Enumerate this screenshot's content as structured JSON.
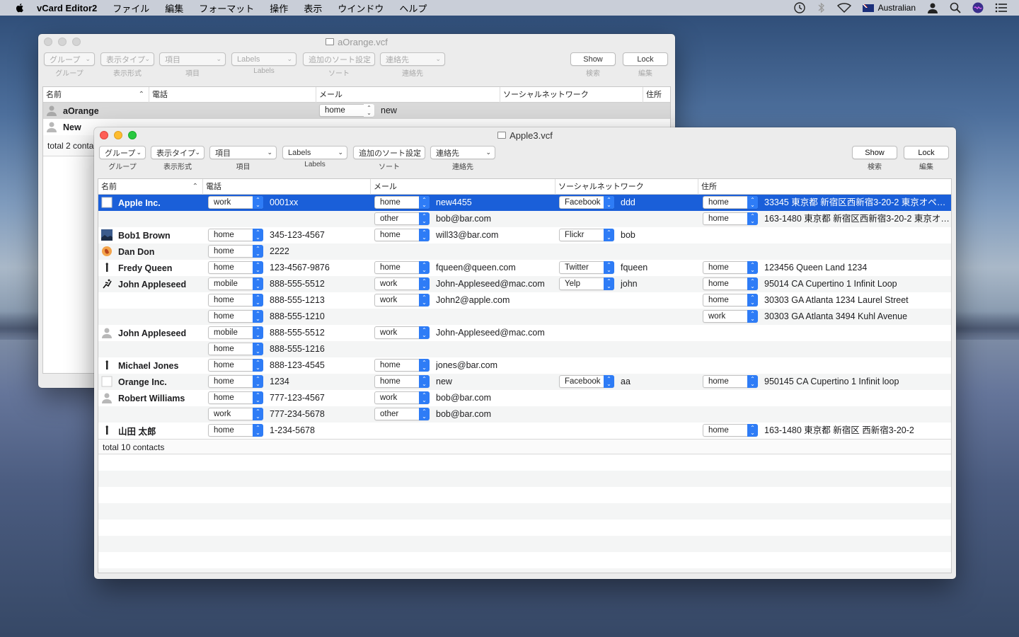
{
  "menubar": {
    "app_name": "vCard Editor2",
    "items": [
      "ファイル",
      "編集",
      "フォーマット",
      "操作",
      "表示",
      "ウインドウ",
      "ヘルプ"
    ],
    "input_source": "Australian"
  },
  "back_window": {
    "title": "aOrange.vcf",
    "toolbar": {
      "popups": [
        {
          "value": "グループ",
          "label": "グループ"
        },
        {
          "value": "表示タイプ",
          "label": "表示形式"
        },
        {
          "value": "項目",
          "label": "項目"
        },
        {
          "value": "Labels",
          "label": "Labels"
        },
        {
          "value": "追加のソート設定",
          "label": "ソート"
        },
        {
          "value": "連絡先",
          "label": "連絡先"
        }
      ],
      "show_button": "Show",
      "show_label": "検索",
      "lock_button": "Lock",
      "lock_label": "編集"
    },
    "columns": [
      "名前",
      "電話",
      "メール",
      "ソーシャルネットワーク",
      "住所"
    ],
    "rows": [
      {
        "name": "aOrange",
        "email_type": "home",
        "email": "new"
      },
      {
        "name": "New"
      }
    ],
    "footer": "total 2 contacts"
  },
  "front_window": {
    "title": "Apple3.vcf",
    "toolbar": {
      "popups": [
        {
          "value": "グループ",
          "label": "グループ"
        },
        {
          "value": "表示タイプ",
          "label": "表示形式"
        },
        {
          "value": "項目",
          "label": "項目"
        },
        {
          "value": "Labels",
          "label": "Labels"
        },
        {
          "value": "追加のソート設定",
          "label": "ソート"
        },
        {
          "value": "連絡先",
          "label": "連絡先"
        }
      ],
      "show_button": "Show",
      "show_label": "検索",
      "lock_button": "Lock",
      "lock_label": "編集"
    },
    "columns": [
      "名前",
      "電話",
      "メール",
      "ソーシャルネットワーク",
      "住所"
    ],
    "rows": [
      {
        "name": "Apple Inc.",
        "avatar": "blank-square",
        "selected": true,
        "phone_type": "work",
        "phone": "0001xx",
        "email_type": "home",
        "email": "new4455",
        "social_type": "Facebook",
        "social": "ddd",
        "addr_type": "home",
        "addr": "33345 東京都 新宿区西新宿3-20-2 東京オペラ…"
      },
      {
        "name": "",
        "email_type": "other",
        "email": "bob@bar.com",
        "addr_type": "home",
        "addr": "163-1480 東京都 新宿区西新宿3-20-2 東京オ…"
      },
      {
        "name": "Bob1 Brown",
        "avatar": "landscape-photo",
        "phone_type": "home",
        "phone": "345-123-4567",
        "email_type": "home",
        "email": "will33@bar.com",
        "social_type": "Flickr",
        "social": "bob"
      },
      {
        "name": "Dan Don",
        "avatar": "orange-photo",
        "phone_type": "home",
        "phone": "2222"
      },
      {
        "name": "Fredy Queen",
        "avatar": "figure-photo",
        "phone_type": "home",
        "phone": "123-4567-9876",
        "email_type": "home",
        "email": "fqueen@queen.com",
        "social_type": "Twitter",
        "social": "fqueen",
        "addr_type": "home",
        "addr": "123456 Queen Land 1234"
      },
      {
        "name": "John Appleseed",
        "avatar": "runner-photo",
        "phone_type": "mobile",
        "phone": "888-555-5512",
        "email_type": "work",
        "email": "John-Appleseed@mac.com",
        "social_type": "Yelp",
        "social": "john",
        "addr_type": "home",
        "addr": "95014 CA Cupertino 1 Infinit Loop"
      },
      {
        "name": "",
        "phone_type": "home",
        "phone": "888-555-1213",
        "email_type": "work",
        "email": "John2@apple.com",
        "addr_type": "home",
        "addr": "30303 GA Atlanta 1234 Laurel Street"
      },
      {
        "name": "",
        "phone_type": "home",
        "phone": "888-555-1210",
        "addr_type": "work",
        "addr": "30303 GA Atlanta 3494 Kuhl Avenue"
      },
      {
        "name": "John Appleseed",
        "avatar": "person-placeholder",
        "phone_type": "mobile",
        "phone": "888-555-5512",
        "email_type": "work",
        "email": "John-Appleseed@mac.com"
      },
      {
        "name": "",
        "phone_type": "home",
        "phone": "888-555-1216"
      },
      {
        "name": "Michael Jones",
        "avatar": "figure-photo",
        "phone_type": "home",
        "phone": "888-123-4545",
        "email_type": "home",
        "email": "jones@bar.com"
      },
      {
        "name": "Orange Inc.",
        "avatar": "blank-square",
        "phone_type": "home",
        "phone": "1234",
        "email_type": "home",
        "email": "new",
        "social_type": "Facebook",
        "social": "aa",
        "addr_type": "home",
        "addr": "950145 CA Cupertino 1 Infinit loop"
      },
      {
        "name": "Robert Williams",
        "avatar": "person-placeholder",
        "phone_type": "home",
        "phone": "777-123-4567",
        "email_type": "work",
        "email": "bob@bar.com"
      },
      {
        "name": "",
        "phone_type": "work",
        "phone": "777-234-5678",
        "email_type": "other",
        "email": "bob@bar.com"
      },
      {
        "name": "山田 太郎",
        "avatar": "figure-photo",
        "phone_type": "home",
        "phone": "1-234-5678",
        "addr_type": "home",
        "addr": "163-1480 東京都 新宿区 西新宿3-20-2"
      }
    ],
    "footer": "total 10 contacts"
  },
  "colors": {
    "selection": "#1a5fd9",
    "stepper": "#2e7cf6",
    "divider": "#e0392f"
  }
}
